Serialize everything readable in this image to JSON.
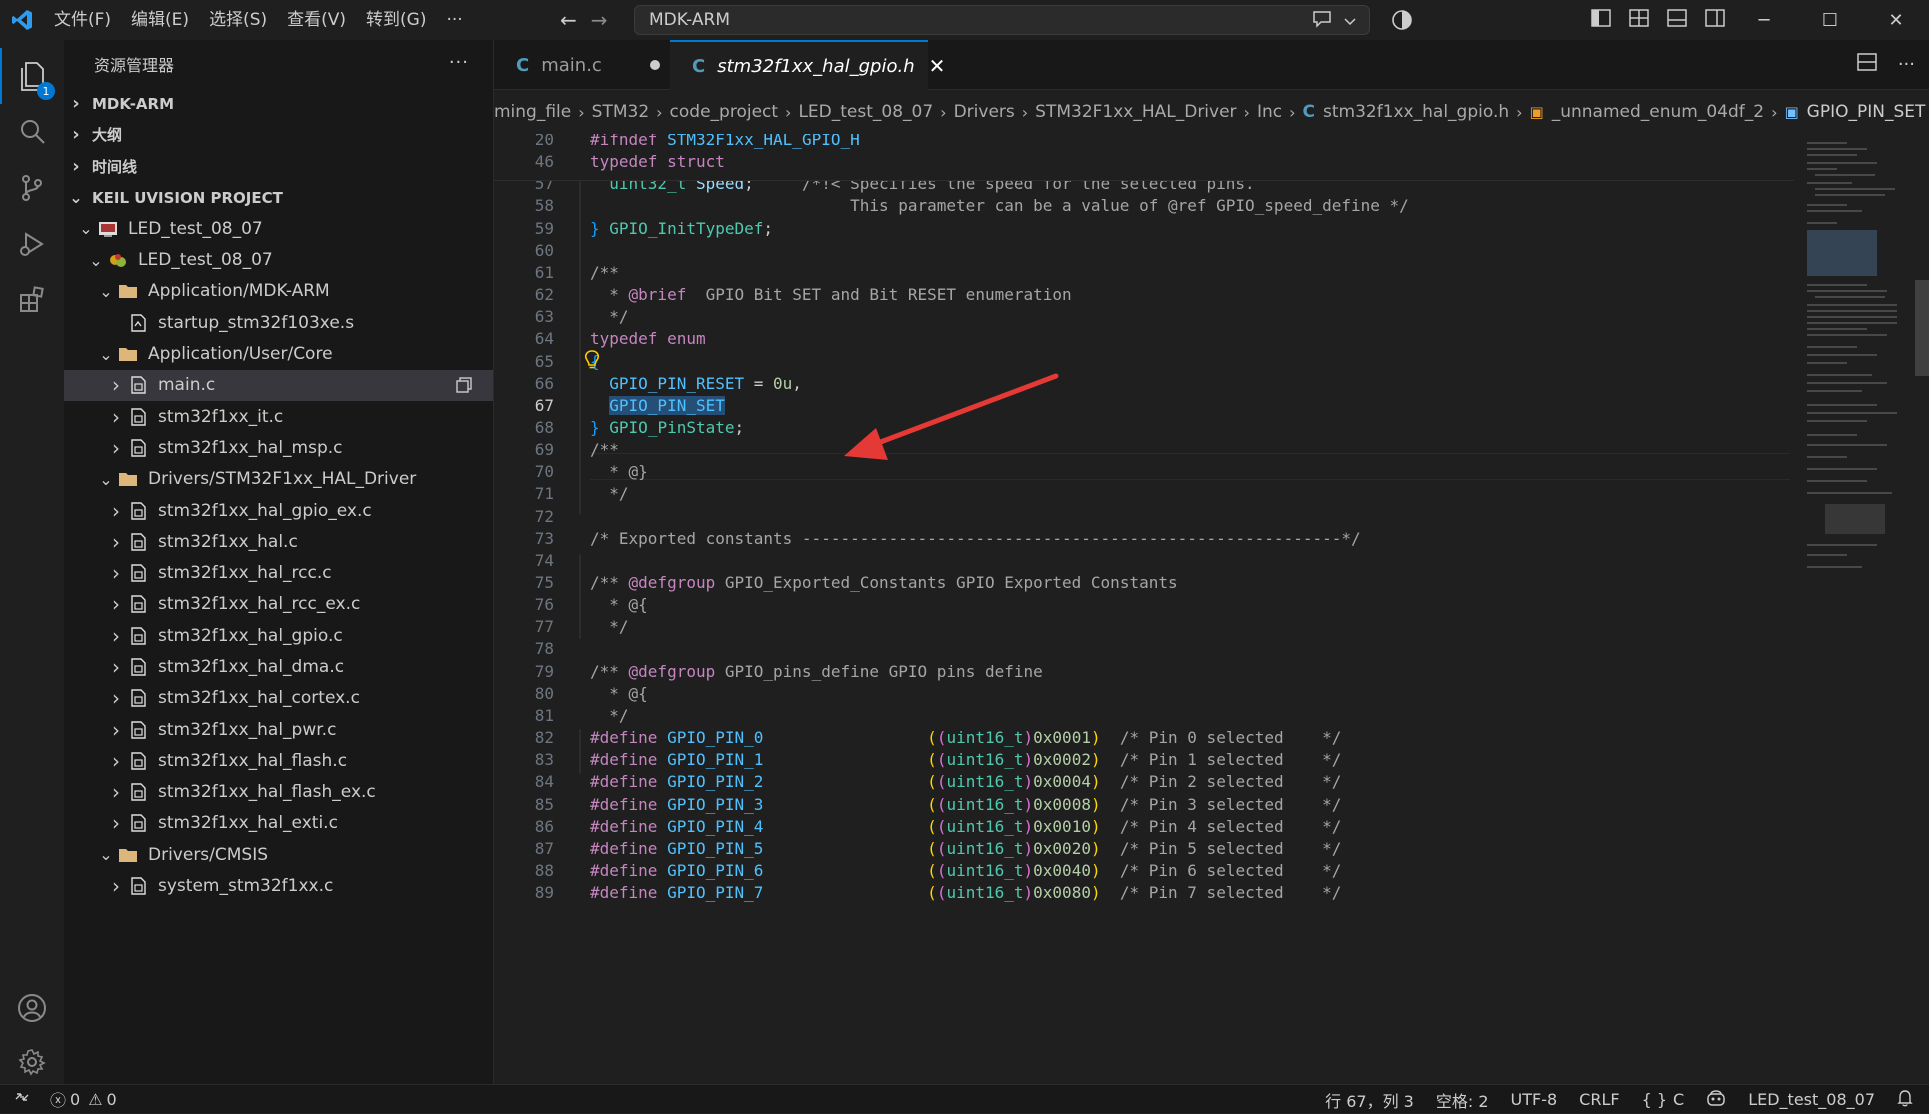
{
  "titlebar": {
    "menu": [
      "文件(F)",
      "编辑(E)",
      "选择(S)",
      "查看(V)",
      "转到(G)",
      "···"
    ],
    "search_text": "MDK-ARM",
    "window_controls": [
      "minimize-icon",
      "maximize-icon",
      "close-icon"
    ]
  },
  "activity": {
    "items": [
      "explorer-icon",
      "search-icon",
      "source-control-icon",
      "run-debug-icon",
      "extensions-icon",
      "account-icon",
      "gear-icon"
    ],
    "explorer_badge": "1"
  },
  "sidebar": {
    "title": "资源管理器",
    "more": "···",
    "sections": [
      {
        "label": "MDK-ARM"
      },
      {
        "label": "大纲"
      },
      {
        "label": "时间线"
      },
      {
        "label": "KEIL UVISION PROJECT"
      }
    ],
    "tree": [
      {
        "label": "LED_test_08_07",
        "indent": 1,
        "chev": "v",
        "icon": "project"
      },
      {
        "label": "LED_test_08_07",
        "indent": 2,
        "chev": "v",
        "icon": "target"
      },
      {
        "label": "Application/MDK-ARM",
        "indent": 3,
        "chev": "v",
        "icon": "folder"
      },
      {
        "label": "startup_stm32f103xe.s",
        "indent": 4,
        "chev": "",
        "icon": "asm"
      },
      {
        "label": "Application/User/Core",
        "indent": 3,
        "chev": "v",
        "icon": "folder"
      },
      {
        "label": "main.c",
        "indent": 4,
        "chev": ">",
        "icon": "file",
        "selected": true
      },
      {
        "label": "stm32f1xx_it.c",
        "indent": 4,
        "chev": ">",
        "icon": "file"
      },
      {
        "label": "stm32f1xx_hal_msp.c",
        "indent": 4,
        "chev": ">",
        "icon": "file"
      },
      {
        "label": "Drivers/STM32F1xx_HAL_Driver",
        "indent": 3,
        "chev": "v",
        "icon": "folder"
      },
      {
        "label": "stm32f1xx_hal_gpio_ex.c",
        "indent": 4,
        "chev": ">",
        "icon": "file"
      },
      {
        "label": "stm32f1xx_hal.c",
        "indent": 4,
        "chev": ">",
        "icon": "file"
      },
      {
        "label": "stm32f1xx_hal_rcc.c",
        "indent": 4,
        "chev": ">",
        "icon": "file"
      },
      {
        "label": "stm32f1xx_hal_rcc_ex.c",
        "indent": 4,
        "chev": ">",
        "icon": "file"
      },
      {
        "label": "stm32f1xx_hal_gpio.c",
        "indent": 4,
        "chev": ">",
        "icon": "file"
      },
      {
        "label": "stm32f1xx_hal_dma.c",
        "indent": 4,
        "chev": ">",
        "icon": "file"
      },
      {
        "label": "stm32f1xx_hal_cortex.c",
        "indent": 4,
        "chev": ">",
        "icon": "file"
      },
      {
        "label": "stm32f1xx_hal_pwr.c",
        "indent": 4,
        "chev": ">",
        "icon": "file"
      },
      {
        "label": "stm32f1xx_hal_flash.c",
        "indent": 4,
        "chev": ">",
        "icon": "file"
      },
      {
        "label": "stm32f1xx_hal_flash_ex.c",
        "indent": 4,
        "chev": ">",
        "icon": "file"
      },
      {
        "label": "stm32f1xx_hal_exti.c",
        "indent": 4,
        "chev": ">",
        "icon": "file"
      },
      {
        "label": "Drivers/CMSIS",
        "indent": 3,
        "chev": "v",
        "icon": "folder"
      },
      {
        "label": "system_stm32f1xx.c",
        "indent": 4,
        "chev": ">",
        "icon": "file"
      }
    ]
  },
  "tabs": [
    {
      "label": "main.c",
      "icon": "C",
      "modified": true,
      "active": false
    },
    {
      "label": "stm32f1xx_hal_gpio.h",
      "icon": "C",
      "modified": false,
      "active": true
    }
  ],
  "breadcrumb": [
    "ming_file",
    "STM32",
    "code_project",
    "LED_test_08_07",
    "Drivers",
    "STM32F1xx_HAL_Driver",
    "Inc",
    "stm32f1xx_hal_gpio.h",
    "_unnamed_enum_04df_2",
    "GPIO_PIN_SET"
  ],
  "editor": {
    "current_line": "67",
    "lines": [
      {
        "n": "20",
        "html": "<span class='def'>#ifndef</span> <span class='mac'>STM32F1xx_HAL_GPIO_H</span>"
      },
      {
        "n": "46",
        "html": "<span class='k'>typedef</span> <span class='k'>struct</span>"
      },
      {
        "n": "57",
        "html": "  <span class='t'>uint32_t</span> <span class='var'>Speed</span>;     <span class='c'>/*!&lt; Specifies the speed for the selected pins.</span>"
      },
      {
        "n": "58",
        "html": "<span class='c'>                           This parameter can be a value of @ref GPIO_speed_define */</span>"
      },
      {
        "n": "59",
        "html": "<span class='brk'>}</span> <span class='t'>GPIO_InitTypeDef</span>;"
      },
      {
        "n": "60",
        "html": ""
      },
      {
        "n": "61",
        "html": "<span class='c'>/**</span>"
      },
      {
        "n": "62",
        "html": "<span class='c'>  * </span><span class='tag'>@brief</span><span class='c'>  GPIO Bit SET and Bit RESET enumeration</span>"
      },
      {
        "n": "63",
        "html": "<span class='c'>  */</span>"
      },
      {
        "n": "64",
        "html": "<span class='k'>typedef</span> <span class='k'>enum</span>"
      },
      {
        "n": "65",
        "html": "<span class='brk'>{</span>"
      },
      {
        "n": "66",
        "html": "  <span class='mac'>GPIO_PIN_RESET</span> = <span class='n'>0u</span>,"
      },
      {
        "n": "67",
        "html": "  <span class='mac sel'>GPIO_PIN_SET</span>"
      },
      {
        "n": "68",
        "html": "<span class='brk'>}</span> <span class='t'>GPIO_PinState</span>;"
      },
      {
        "n": "69",
        "html": "<span class='c'>/**</span>"
      },
      {
        "n": "70",
        "html": "<span class='c'>  * @}</span>"
      },
      {
        "n": "71",
        "html": "<span class='c'>  */</span>"
      },
      {
        "n": "72",
        "html": ""
      },
      {
        "n": "73",
        "html": "<span class='c'>/* Exported constants --------------------------------------------------------*/</span>"
      },
      {
        "n": "74",
        "html": ""
      },
      {
        "n": "75",
        "html": "<span class='c'>/** </span><span class='tag'>@defgroup</span><span class='c'> GPIO_Exported_Constants GPIO Exported Constants</span>"
      },
      {
        "n": "76",
        "html": "<span class='c'>  * @{</span>"
      },
      {
        "n": "77",
        "html": "<span class='c'>  */</span>"
      },
      {
        "n": "78",
        "html": ""
      },
      {
        "n": "79",
        "html": "<span class='c'>/** </span><span class='tag'>@defgroup</span><span class='c'> GPIO_pins_define GPIO pins define</span>"
      },
      {
        "n": "80",
        "html": "<span class='c'>  * @{</span>"
      },
      {
        "n": "81",
        "html": "<span class='c'>  */</span>"
      },
      {
        "n": "82",
        "html": "<span class='def'>#define</span> <span class='mac'>GPIO_PIN_0</span>                 <span class='brk3'>(</span><span class='brk2'>(</span><span class='t'>uint16_t</span><span class='brk2'>)</span><span class='n'>0x0001</span><span class='brk3'>)</span>  <span class='c'>/* Pin 0 selected    */</span>"
      },
      {
        "n": "83",
        "html": "<span class='def'>#define</span> <span class='mac'>GPIO_PIN_1</span>                 <span class='brk3'>(</span><span class='brk2'>(</span><span class='t'>uint16_t</span><span class='brk2'>)</span><span class='n'>0x0002</span><span class='brk3'>)</span>  <span class='c'>/* Pin 1 selected    */</span>"
      },
      {
        "n": "84",
        "html": "<span class='def'>#define</span> <span class='mac'>GPIO_PIN_2</span>                 <span class='brk3'>(</span><span class='brk2'>(</span><span class='t'>uint16_t</span><span class='brk2'>)</span><span class='n'>0x0004</span><span class='brk3'>)</span>  <span class='c'>/* Pin 2 selected    */</span>"
      },
      {
        "n": "85",
        "html": "<span class='def'>#define</span> <span class='mac'>GPIO_PIN_3</span>                 <span class='brk3'>(</span><span class='brk2'>(</span><span class='t'>uint16_t</span><span class='brk2'>)</span><span class='n'>0x0008</span><span class='brk3'>)</span>  <span class='c'>/* Pin 3 selected    */</span>"
      },
      {
        "n": "86",
        "html": "<span class='def'>#define</span> <span class='mac'>GPIO_PIN_4</span>                 <span class='brk3'>(</span><span class='brk2'>(</span><span class='t'>uint16_t</span><span class='brk2'>)</span><span class='n'>0x0010</span><span class='brk3'>)</span>  <span class='c'>/* Pin 4 selected    */</span>"
      },
      {
        "n": "87",
        "html": "<span class='def'>#define</span> <span class='mac'>GPIO_PIN_5</span>                 <span class='brk3'>(</span><span class='brk2'>(</span><span class='t'>uint16_t</span><span class='brk2'>)</span><span class='n'>0x0020</span><span class='brk3'>)</span>  <span class='c'>/* Pin 5 selected    */</span>"
      },
      {
        "n": "88",
        "html": "<span class='def'>#define</span> <span class='mac'>GPIO_PIN_6</span>                 <span class='brk3'>(</span><span class='brk2'>(</span><span class='t'>uint16_t</span><span class='brk2'>)</span><span class='n'>0x0040</span><span class='brk3'>)</span>  <span class='c'>/* Pin 6 selected    */</span>"
      },
      {
        "n": "89",
        "html": "<span class='def'>#define</span> <span class='mac'>GPIO_PIN_7</span>                 <span class='brk3'>(</span><span class='brk2'>(</span><span class='t'>uint16_t</span><span class='brk2'>)</span><span class='n'>0x0080</span><span class='brk3'>)</span>  <span class='c'>/* Pin 7 selected    */</span>"
      }
    ]
  },
  "statusbar": {
    "errors": "0",
    "warnings": "0",
    "position": "行 67，列 3",
    "spaces": "空格: 2",
    "encoding": "UTF-8",
    "eol": "CRLF",
    "language": "C",
    "project": "LED_test_08_07"
  },
  "colors": {
    "accent": "#0078d4",
    "annotation_arrow": "#e53935"
  }
}
